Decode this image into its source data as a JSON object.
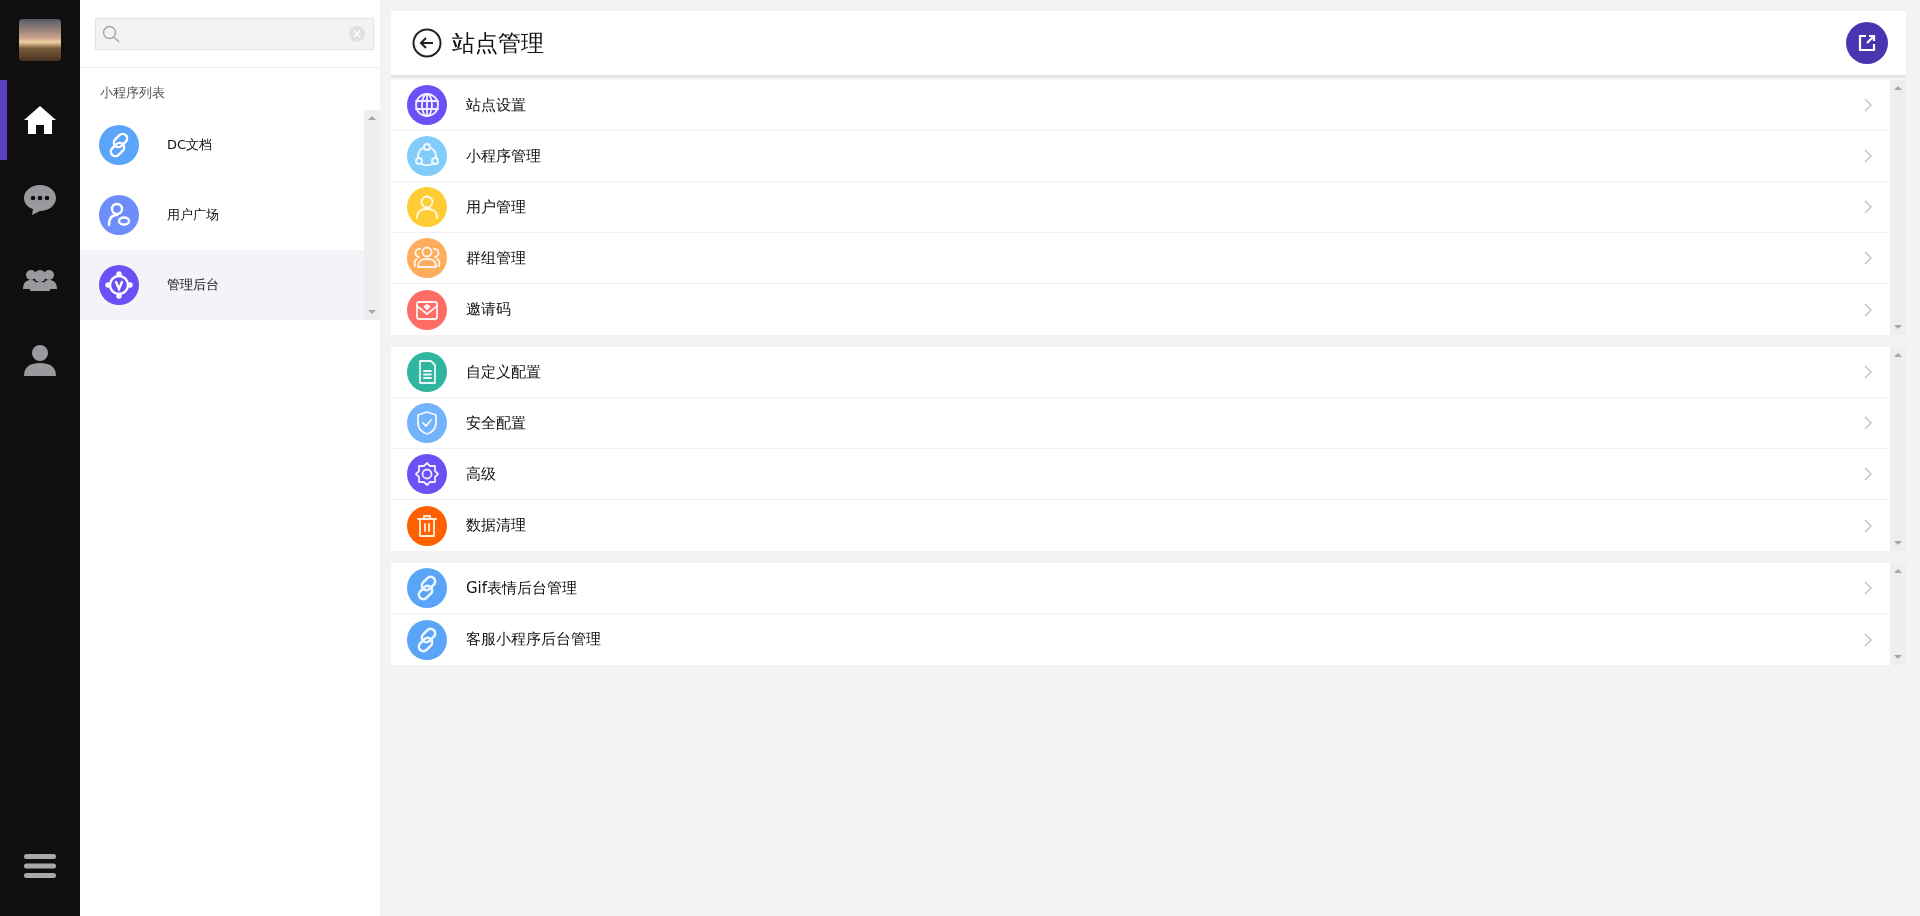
{
  "rail": {
    "items": [
      {
        "kind": "home",
        "selected": true
      },
      {
        "kind": "chat",
        "selected": false
      },
      {
        "kind": "group",
        "selected": false
      },
      {
        "kind": "person",
        "selected": false
      }
    ]
  },
  "sidebar": {
    "section_title": "小程序列表",
    "items": [
      {
        "label": "DC文档",
        "kind": "link",
        "color": "#5aa5fa",
        "selected": false
      },
      {
        "label": "用户广场",
        "kind": "user",
        "color": "#6d8dfa",
        "selected": false
      },
      {
        "label": "管理后台",
        "kind": "admin",
        "color": "#6c4ff5",
        "selected": true
      }
    ]
  },
  "page": {
    "title": "站点管理",
    "groups": [
      [
        {
          "label": "站点设置",
          "kind": "globe",
          "color": "#6c4ff5"
        },
        {
          "label": "小程序管理",
          "kind": "nodes",
          "color": "#82ccfc"
        },
        {
          "label": "用户管理",
          "kind": "user",
          "color": "#ffcc33"
        },
        {
          "label": "群组管理",
          "kind": "group",
          "color": "#ffad5c"
        },
        {
          "label": "邀请码",
          "kind": "mail",
          "color": "#fd6d66"
        }
      ],
      [
        {
          "label": "自定义配置",
          "kind": "doc",
          "color": "#2fb5a0"
        },
        {
          "label": "安全配置",
          "kind": "shield",
          "color": "#72b3fb"
        },
        {
          "label": "高级",
          "kind": "gear",
          "color": "#6c4ff5"
        },
        {
          "label": "数据清理",
          "kind": "trash",
          "color": "#ff6000"
        }
      ],
      [
        {
          "label": "Gif表情后台管理",
          "kind": "link",
          "color": "#5aa5fa"
        },
        {
          "label": "客服小程序后台管理",
          "kind": "link",
          "color": "#5aa5fa"
        }
      ]
    ]
  }
}
